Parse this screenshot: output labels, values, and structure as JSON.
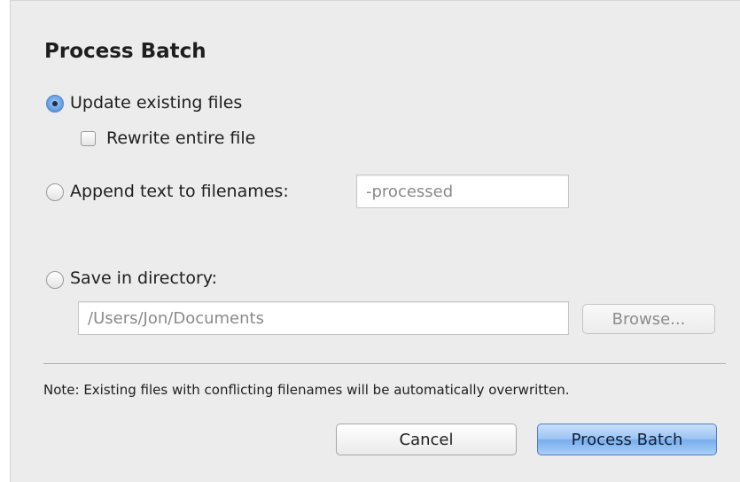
{
  "dialog": {
    "title": "Process Batch"
  },
  "options": {
    "update_existing": {
      "label": "Update existing files",
      "selected": true
    },
    "rewrite_entire": {
      "label": "Rewrite entire file",
      "checked": false
    },
    "append_text": {
      "label": "Append text to filenames:",
      "selected": false,
      "placeholder": "-processed"
    },
    "save_directory": {
      "label": "Save in directory:",
      "selected": false,
      "placeholder": "/Users/Jon/Documents",
      "browse_label": "Browse..."
    }
  },
  "note": "Note: Existing files with conflicting filenames will be automatically overwritten.",
  "buttons": {
    "cancel_label": "Cancel",
    "process_label": "Process Batch"
  },
  "colors": {
    "primary_button": "#9cc4f2",
    "radio_selected": "#6aa3e6",
    "dialog_background": "#ececec"
  }
}
